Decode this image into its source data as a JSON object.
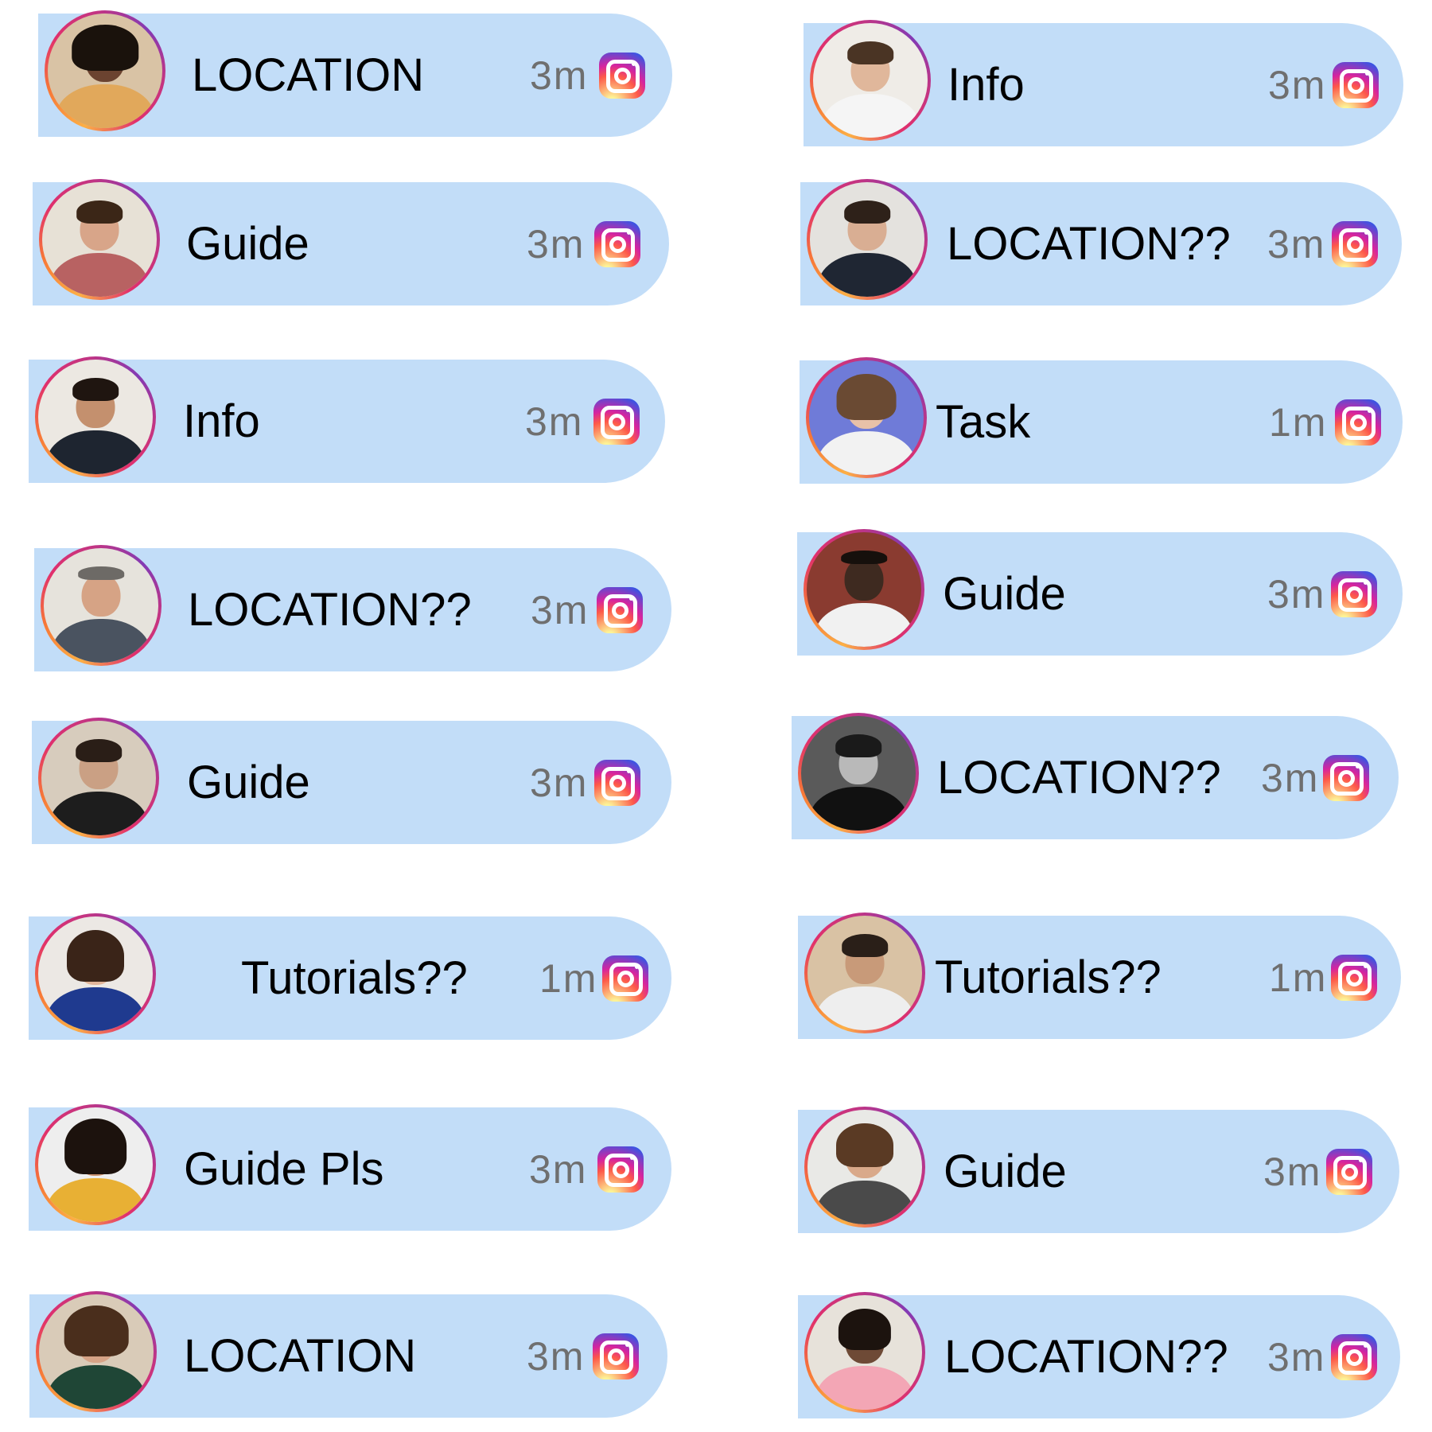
{
  "notifications": [
    {
      "message": "LOCATION",
      "time": "3m",
      "icon": "instagram-icon"
    },
    {
      "message": "Guide",
      "time": "3m",
      "icon": "instagram-icon"
    },
    {
      "message": "Info",
      "time": "3m",
      "icon": "instagram-icon"
    },
    {
      "message": "LOCATION??",
      "time": "3m",
      "icon": "instagram-icon"
    },
    {
      "message": "Guide",
      "time": "3m",
      "icon": "instagram-icon"
    },
    {
      "message": "Tutorials??",
      "time": "1m",
      "icon": "instagram-icon"
    },
    {
      "message": "Guide Pls",
      "time": "3m",
      "icon": "instagram-icon"
    },
    {
      "message": "LOCATION",
      "time": "3m",
      "icon": "instagram-icon"
    },
    {
      "message": "Info",
      "time": "3m",
      "icon": "instagram-icon"
    },
    {
      "message": "LOCATION??",
      "time": "3m",
      "icon": "instagram-icon"
    },
    {
      "message": "Task",
      "time": "1m",
      "icon": "instagram-icon"
    },
    {
      "message": "Guide",
      "time": "3m",
      "icon": "instagram-icon"
    },
    {
      "message": "LOCATION??",
      "time": "3m",
      "icon": "instagram-icon"
    },
    {
      "message": "Tutorials??",
      "time": "1m",
      "icon": "instagram-icon"
    },
    {
      "message": "Guide",
      "time": "3m",
      "icon": "instagram-icon"
    },
    {
      "message": "LOCATION??",
      "time": "3m",
      "icon": "instagram-icon"
    }
  ],
  "colors": {
    "pill_background": "#c2ddf8",
    "message_text": "#000000",
    "time_text": "#6f6f6f",
    "avatar_ring": [
      "#fcaf45",
      "#e1306c",
      "#833ab4"
    ]
  }
}
